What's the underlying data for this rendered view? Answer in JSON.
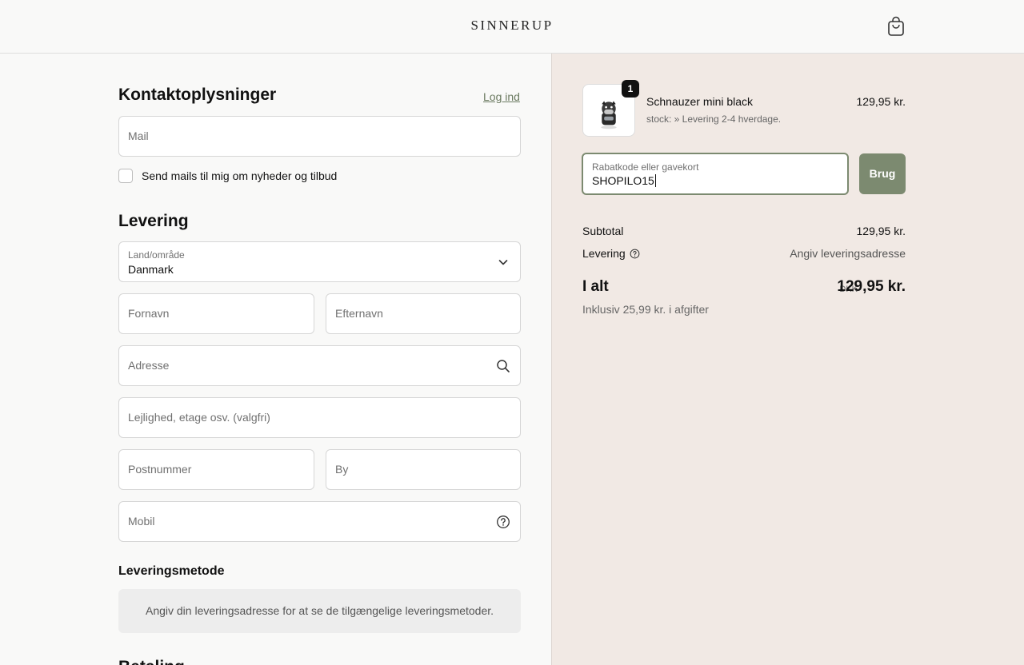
{
  "header": {
    "brand": "SINNERUP",
    "cart_icon": "shopping-bag-icon"
  },
  "contact": {
    "title": "Kontaktoplysninger",
    "login_link": "Log ind",
    "email_placeholder": "Mail",
    "newsletter_label": "Send mails til mig om nyheder og tilbud"
  },
  "delivery": {
    "title": "Levering",
    "country_label": "Land/område",
    "country_value": "Danmark",
    "firstname_placeholder": "Fornavn",
    "lastname_placeholder": "Efternavn",
    "address_placeholder": "Adresse",
    "apartment_placeholder": "Lejlighed, etage osv. (valgfri)",
    "postal_placeholder": "Postnummer",
    "city_placeholder": "By",
    "phone_placeholder": "Mobil"
  },
  "shipping_method": {
    "title": "Leveringsmetode",
    "info": "Angiv din leveringsadresse for at se de tilgængelige leveringsmetoder."
  },
  "payment": {
    "title_partial": "Betaling"
  },
  "order": {
    "item": {
      "quantity": "1",
      "name": "Schnauzer mini black",
      "stock": "stock: » Levering 2-4 hverdage.",
      "price": "129,95 kr."
    },
    "discount": {
      "label": "Rabatkode eller gavekort",
      "value": "SHOPILO15",
      "button": "Brug"
    },
    "subtotal_label": "Subtotal",
    "subtotal_value": "129,95 kr.",
    "shipping_label": "Levering",
    "shipping_value": "Angiv leveringsadresse",
    "total_label": "I alt",
    "total_currency": "DKK",
    "total_value": "129,95 kr.",
    "tax_note": "Inklusiv 25,99 kr. i afgifter"
  },
  "colors": {
    "accent": "#7c8a70",
    "summary_bg": "#f1e9e4",
    "form_bg": "#f9f9f8"
  }
}
